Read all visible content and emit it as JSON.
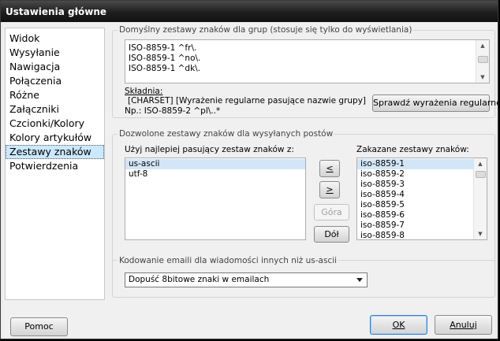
{
  "window": {
    "title": "Ustawienia główne"
  },
  "sidebar": {
    "items": [
      {
        "label": "Widok"
      },
      {
        "label": "Wysyłanie"
      },
      {
        "label": "Nawigacja"
      },
      {
        "label": "Połączenia"
      },
      {
        "label": "Różne"
      },
      {
        "label": "Załączniki"
      },
      {
        "label": "Czcionki/Kolory"
      },
      {
        "label": "Kolory artykułów"
      },
      {
        "label": "Zestawy znaków"
      },
      {
        "label": "Potwierdzenia"
      }
    ],
    "selected": "Zestawy znaków"
  },
  "group_charsets": {
    "legend": "Domyślny zestawy znaków dla grup (stosuje się tylko do wyświetlania)",
    "lines": [
      "ISO-8859-1 ^fr\\.",
      "ISO-8859-1 ^no\\.",
      "ISO-8859-1 ^dk\\."
    ],
    "syntax_label": "Składnia:",
    "syntax_text": "[CHARSET] [Wyrażenie regularne pasujące nazwie grupy]",
    "example_text": "Np.: ISO-8859-2 ^pl\\..*",
    "check_button": "Sprawdź wyrażenia regularne"
  },
  "group_posting": {
    "legend": "Dozwolone zestawy znaków dla wysyłanych postów",
    "use_label": "Użyj najlepiej pasujący zestaw znaków z:",
    "use_list": [
      "us-ascii",
      "utf-8"
    ],
    "forbidden_label": "Zakazane zestawy znaków:",
    "forbidden_list": [
      "iso-8859-1",
      "iso-8859-2",
      "iso-8859-3",
      "iso-8859-4",
      "iso-8859-5",
      "iso-8859-6",
      "iso-8859-7",
      "iso-8859-8"
    ],
    "btn_left": "<",
    "btn_right": ">",
    "btn_up": "Góra",
    "btn_down": "Dół"
  },
  "group_email": {
    "legend": "Kodowanie emaili dla wiadomości innych niż us-ascii",
    "selected_option": "Dopuść 8bitowe znaki w emailach"
  },
  "footer": {
    "help_button": "Pomoc",
    "ok_button": "OK",
    "cancel_button": "Anuluj"
  }
}
